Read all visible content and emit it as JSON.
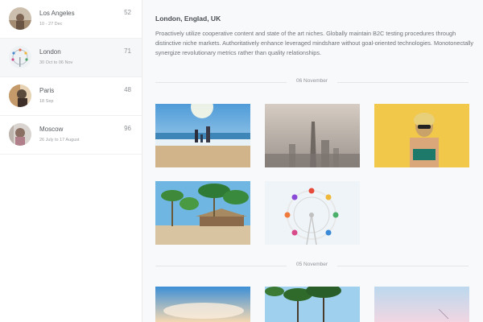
{
  "sidebar": {
    "trips": [
      {
        "city": "Los Angeles",
        "dates": "10 - 27 Dec",
        "count": "52",
        "active": false
      },
      {
        "city": "London",
        "dates": "30 Oct to 06 Nov",
        "count": "71",
        "active": true
      },
      {
        "city": "Paris",
        "dates": "18 Sep",
        "count": "48",
        "active": false
      },
      {
        "city": "Moscow",
        "dates": "26 July to 17 August",
        "count": "96",
        "active": false
      }
    ]
  },
  "main": {
    "title": "London, Englad, UK",
    "description": "Proactively utilize cooperative content and state of the art niches. Globally maintain B2C testing procedures through distinctive niche markets. Authoritatively enhance leveraged mindshare without goal-oriented technologies. Monotonectally synergize revolutionary metrics rather than quality relationships.",
    "groups": [
      {
        "date": "06 November"
      },
      {
        "date": "05 November"
      }
    ]
  },
  "colors": {
    "sidebar_active": "#f6f7f9",
    "main_bg": "#f8f9fb",
    "divider": "#e4e6e9"
  }
}
